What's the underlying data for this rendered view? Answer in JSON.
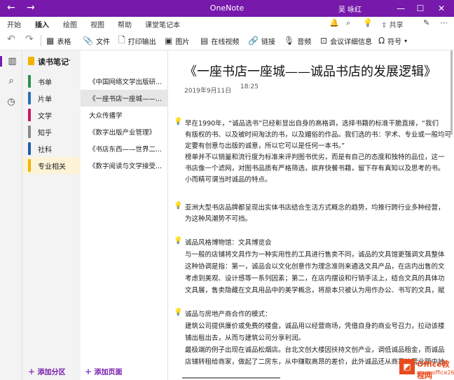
{
  "window": {
    "title": "OneNote",
    "user": "吴 咏红",
    "back_icon": "←",
    "forward_icon": "→",
    "minimize": "—",
    "maximize": "☐",
    "close": "✕"
  },
  "tabs": [
    {
      "label": "开始"
    },
    {
      "label": "插入"
    },
    {
      "label": "绘图"
    },
    {
      "label": "视图"
    },
    {
      "label": "帮助"
    },
    {
      "label": "课堂笔记本"
    }
  ],
  "right_commands": {
    "share": "共享",
    "more": "⋯"
  },
  "toolbar": {
    "table": "表格",
    "file": "文件",
    "printout": "打印输出",
    "picture": "图片",
    "online_video": "在线视频",
    "link": "链接",
    "audio": "音频",
    "meeting": "会议详细信息",
    "symbol": "符号"
  },
  "notebook": {
    "name": "读书笔记",
    "sections": [
      {
        "label": "书单",
        "color": "#2f8e4f"
      },
      {
        "label": "片单",
        "color": "#2b6eb5"
      },
      {
        "label": "文学",
        "color": "#c7195f"
      },
      {
        "label": "知乎",
        "color": "#8a8a8a"
      },
      {
        "label": "社科",
        "color": "#1d5ea8"
      },
      {
        "label": "专业相关",
        "color": "#f1b300"
      }
    ],
    "add_section": "添加分区"
  },
  "pages": {
    "items": [
      {
        "label": "《中国网络文学出版研..."
      },
      {
        "label": "《一座书店一座城——..."
      },
      {
        "label": "大众传播学"
      },
      {
        "label": "《数字出版产业管理》"
      },
      {
        "label": "《书店东西——世界二..."
      },
      {
        "label": "《数字阅读与文学接受..."
      }
    ],
    "add_page": "添加页面"
  },
  "page": {
    "title": "《一座书店一座城——诚品书店的发展逻辑》",
    "date": "2019年9月11日",
    "time": "18:25",
    "paragraphs": [
      {
        "lines": [
          "早在1990年，“诚品选书”已经彰显出自身的高格调，选择书籍的标准干脆直接，“我们",
          "有版权的书、以及被时间淘汰的书，以及媚俗的作品。我们选的书：学术、专业或一般均可",
          "定要有创意与出版的诚意，所以它可以是任何一本书。”",
          "榜单并不以销量和流行度为标准来评判图书优劣，而是有自己的态度和独特的品位，这一",
          "书店像一个滤网，对图书品质有严格筛选，摈弃快餐书籍，留下存有真知以及思考的书。",
          "小而精可谓当时诚品的特点。"
        ]
      },
      {
        "lines": [
          "亚洲大型书店品牌都呈现出实体书店结合生活方式概念的趋势，均推行跨行业多种经营，",
          "为这种风潮势不可挡。"
        ]
      },
      {
        "lines": [
          "诚品风格博物馆：文具博览会",
          "与一般的店铺将文具作为一种实用性的工具进行售卖不同，诚品的文具馆更强调文具整体",
          "这种协调是指：第一，诚品会以文化创意作为理念准则来遴选文具产品，在店内出售的文",
          "考虑到美观、设计感等一系列因素；第二，在店内摆设和行销手法上，结合文具的具体功",
          "文具展，售卖隐藏在文具用品中的美学概念，将原本只被认为用作办公、书写的文具，赋"
        ]
      },
      {
        "lines": [
          "诚品与房地产商合作的模式：",
          "建筑公司提供廉价或免费的楼盘，诚品用以经营商场，凭借自身的商业号召力，拉动该楼",
          "铺出租出去，从而与建筑公司分享利润。",
          "最极端的例子出现在诚品松烟店。台北文创大楼因扶持文创产业，调低诚品租金，而诚品",
          "店铺转租给商家，做起了二房东，从中赚取高昂的差价，此外诚品还从商家的营业额中抽"
        ]
      }
    ]
  },
  "watermark": {
    "line1": "Office教程网",
    "line2": "www.office26.com"
  }
}
